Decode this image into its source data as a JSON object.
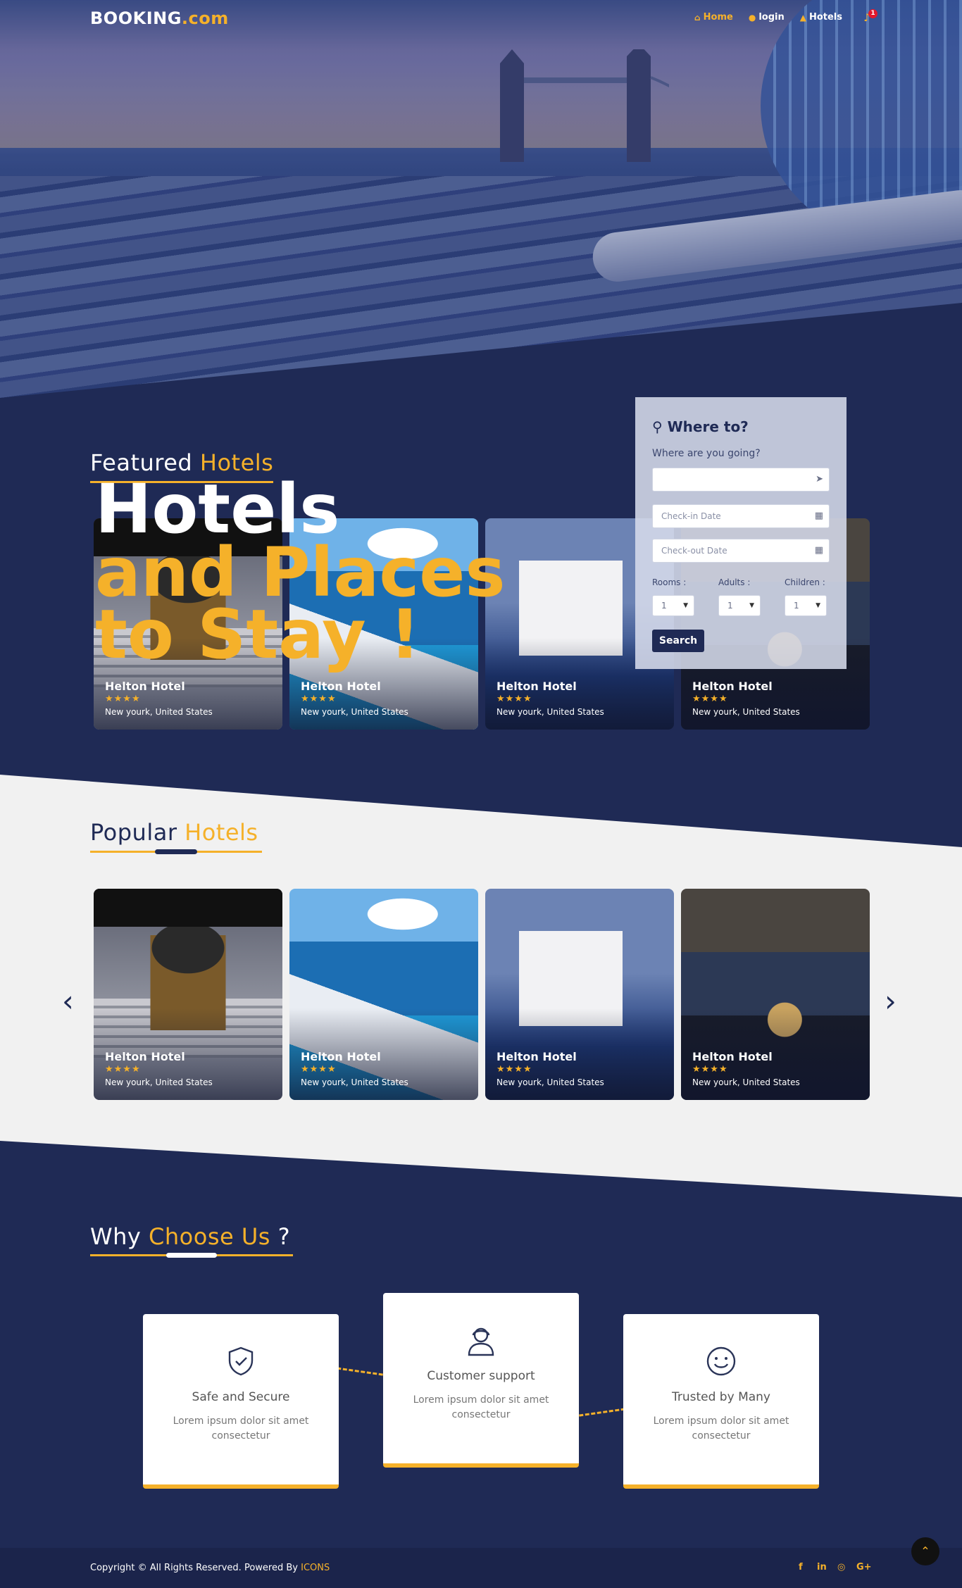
{
  "brand": {
    "name_main": "BOOKING",
    "name_suffix": ".com"
  },
  "nav": {
    "items": [
      {
        "label": "Home",
        "icon": "home-icon",
        "active": true
      },
      {
        "label": "login",
        "icon": "user-icon",
        "active": false
      },
      {
        "label": "Hotels",
        "icon": "hotel-icon",
        "active": false
      }
    ],
    "notifications_count": "1"
  },
  "hero": {
    "line1": "Hotels",
    "line2": "and Places",
    "line3": "to Stay !"
  },
  "featured": {
    "title_plain": "Featured",
    "title_accent": "Hotels",
    "cards": [
      {
        "name": "Helton Hotel",
        "stars": "★★★★",
        "location": "New yourk, United States",
        "image": "entrance"
      },
      {
        "name": "Helton Hotel",
        "stars": "★★★★",
        "location": "New yourk, United States",
        "image": "sea-pool"
      },
      {
        "name": "Helton Hotel",
        "stars": "★★★★",
        "location": "New yourk, United States",
        "image": "villa"
      },
      {
        "name": "Helton Hotel",
        "stars": "★★★★",
        "location": "New yourk, United States",
        "image": "keys"
      }
    ]
  },
  "search": {
    "title": "Where to?",
    "question": "Where are you going?",
    "destination_value": "",
    "checkin_placeholder": "Check-in Date",
    "checkout_placeholder": "Check-out Date",
    "rooms_label": "Rooms :",
    "adults_label": "Adults :",
    "children_label": "Children :",
    "rooms_value": "1",
    "adults_value": "1",
    "children_value": "1",
    "button": "Search"
  },
  "popular": {
    "title_plain": "Popular",
    "title_accent": "Hotels",
    "prev": "‹",
    "next": "›",
    "cards": [
      {
        "name": "Helton Hotel",
        "stars": "★★★★",
        "location": "New yourk, United States",
        "image": "entrance"
      },
      {
        "name": "Helton Hotel",
        "stars": "★★★★",
        "location": "New yourk, United States",
        "image": "sea-pool"
      },
      {
        "name": "Helton Hotel",
        "stars": "★★★★",
        "location": "New yourk, United States",
        "image": "villa"
      },
      {
        "name": "Helton Hotel",
        "stars": "★★★★",
        "location": "New yourk, United States",
        "image": "keys"
      }
    ]
  },
  "why": {
    "title_plain": "Why",
    "title_accent": "Choose Us",
    "title_end": "?",
    "features": [
      {
        "name": "Safe and Secure",
        "desc": "Lorem ipsum dolor sit amet consectetur",
        "icon": "shield-check-icon"
      },
      {
        "name": "Customer support",
        "desc": "Lorem ipsum dolor sit amet consectetur",
        "icon": "headset-user-icon"
      },
      {
        "name": "Trusted by Many",
        "desc": "Lorem ipsum dolor sit amet consectetur",
        "icon": "smiley-icon"
      }
    ]
  },
  "footer": {
    "copyright": "Copyright © All Rights Reserved. Powered By",
    "powered_by": "ICONS",
    "social": [
      "f",
      "in",
      "◎",
      "G+"
    ]
  },
  "colors": {
    "navy": "#1f2a55",
    "accent": "#f5b12a",
    "light": "#f1f1f1"
  }
}
